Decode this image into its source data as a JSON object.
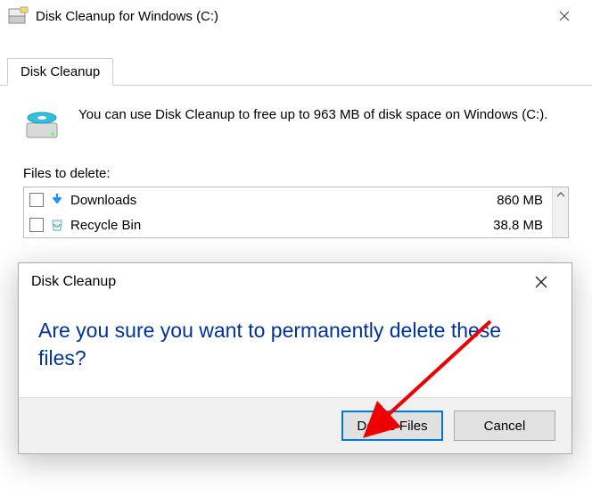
{
  "window": {
    "title": "Disk Cleanup for Windows (C:)"
  },
  "tab": {
    "label": "Disk Cleanup"
  },
  "intro": {
    "text": "You can use Disk Cleanup to free up to 963 MB of disk space on Windows (C:)."
  },
  "section": {
    "label": "Files to delete:"
  },
  "files": [
    {
      "name": "Downloads",
      "size": "860 MB",
      "icon": "download"
    },
    {
      "name": "Recycle Bin",
      "size": "38.8 MB",
      "icon": "recycle"
    }
  ],
  "dialog": {
    "title": "Disk Cleanup",
    "message": "Are you sure you want to permanently delete these files?",
    "primary": "Delete Files",
    "secondary": "Cancel"
  }
}
